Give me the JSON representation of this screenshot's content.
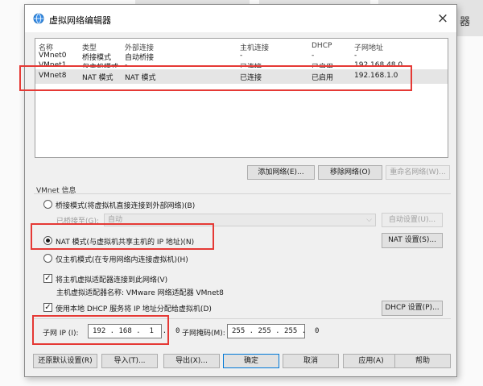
{
  "background": {
    "right_text": "器"
  },
  "window": {
    "title": "虚拟网络编辑器",
    "close": "×"
  },
  "table": {
    "headers": [
      "名称",
      "类型",
      "外部连接",
      "主机连接",
      "DHCP",
      "子网地址"
    ],
    "rows": [
      [
        "VMnet0",
        "桥接模式",
        "自动桥接",
        "-",
        "-",
        "-"
      ],
      [
        "VMnet1",
        "仅主机模式",
        "-",
        "已连接",
        "已启用",
        "192.168.48.0"
      ],
      [
        "VMnet8",
        "NAT 模式",
        "NAT 模式",
        "已连接",
        "已启用",
        "192.168.1.0"
      ]
    ]
  },
  "list_buttons": {
    "add": "添加网络(E)...",
    "remove": "移除网络(O)",
    "rename": "重命名网络(W)..."
  },
  "vmnet_info": {
    "title": "VMnet 信息",
    "bridged": "桥接模式(将虚拟机直接连接到外部网络)(B)",
    "bridged_to_label": "已桥接至(G):",
    "bridged_to_value": "自动",
    "auto_settings": "自动设置(U)...",
    "nat": "NAT 模式(与虚拟机共享主机的 IP 地址)(N)",
    "nat_settings": "NAT 设置(S)...",
    "host_only": "仅主机模式(在专用网络内连接虚拟机)(H)",
    "connect_adapter": "将主机虚拟适配器连接到此网络(V)",
    "adapter_name": "主机虚拟适配器名称: VMware 网络适配器 VMnet8",
    "use_dhcp": "使用本地 DHCP 服务将 IP 地址分配给虚拟机(D)",
    "dhcp_settings": "DHCP 设置(P)...",
    "subnet_ip_label": "子网 IP (I):",
    "subnet_ip": "192 . 168 .  1  .  0",
    "subnet_mask_label": "子网掩码(M):",
    "subnet_mask": "255 . 255 . 255 .  0"
  },
  "footer": {
    "restore": "还原默认设置(R)",
    "import": "导入(T)...",
    "export": "导出(X)...",
    "ok": "确定",
    "cancel": "取消",
    "apply": "应用(A)",
    "help": "帮助"
  },
  "colors": {
    "highlight": "#e53935",
    "selected_row": "#e5e5e5",
    "focus": "#0078d7"
  }
}
